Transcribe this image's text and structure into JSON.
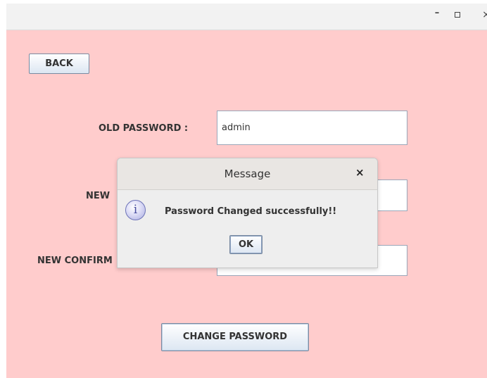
{
  "window": {
    "controls": {
      "minimize": "–",
      "close": "×"
    }
  },
  "form": {
    "back_label": "BACK",
    "old_password_label": "OLD PASSWORD :",
    "old_password_value": "admin",
    "new_password_label": "NEW",
    "new_password_value": "",
    "confirm_label": "NEW CONFIRM",
    "confirm_value": "",
    "change_button_label": "CHANGE PASSWORD"
  },
  "dialog": {
    "title": "Message",
    "close_label": "×",
    "icon": "info-icon",
    "icon_glyph": "i",
    "message": "Password Changed successfully!!",
    "ok_label": "OK"
  },
  "colors": {
    "background": "#ffcccc",
    "titlebar": "#f2f2f2",
    "dialog": "#eeeeee"
  }
}
